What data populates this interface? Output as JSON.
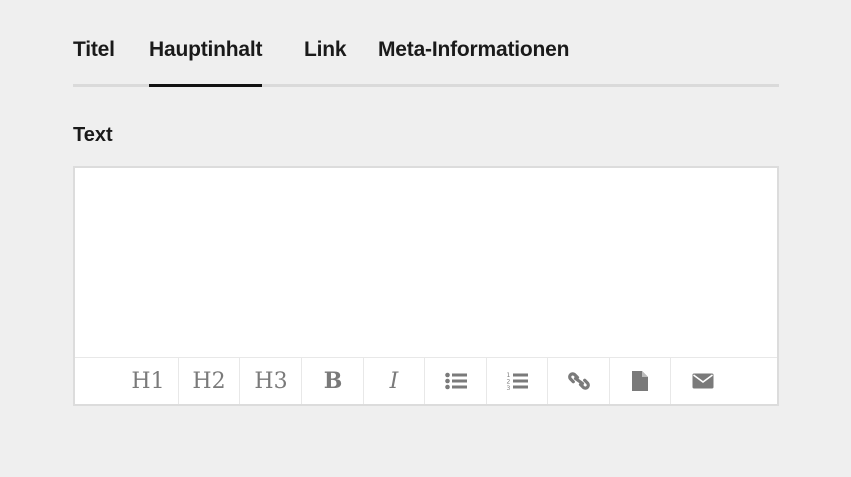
{
  "tabs": [
    {
      "label": "Titel",
      "active": false
    },
    {
      "label": "Hauptinhalt",
      "active": true
    },
    {
      "label": "Link",
      "active": false
    },
    {
      "label": "Meta-Informationen",
      "active": false
    }
  ],
  "field": {
    "label": "Text",
    "value": ""
  },
  "toolbar": {
    "h1": "H1",
    "h2": "H2",
    "h3": "H3",
    "bold": "B",
    "italic": "I",
    "icons": [
      "bullet-list-icon",
      "numbered-list-icon",
      "link-icon",
      "file-icon",
      "envelope-icon"
    ]
  },
  "colors": {
    "background": "#efefef",
    "text": "#1a1a1a",
    "toolbar_icon": "#7a7a7a",
    "tab_underline_active": "#111111",
    "tab_underline": "#dadada"
  }
}
